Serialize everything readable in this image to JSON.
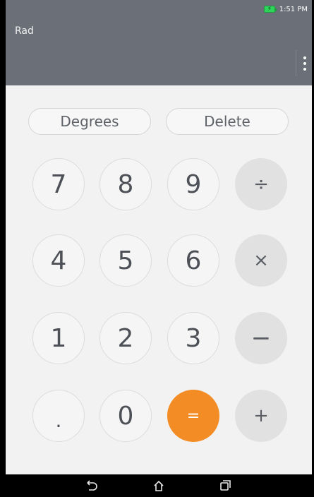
{
  "status_bar": {
    "time": "1:51 PM",
    "battery_icon": "battery-charging-icon"
  },
  "header": {
    "mode_label": "Rad",
    "display_value": "",
    "menu_icon": "overflow-menu-icon"
  },
  "actions": {
    "degrees_label": "Degrees",
    "delete_label": "Delete"
  },
  "keypad": {
    "seven": "7",
    "eight": "8",
    "nine": "9",
    "divide": "÷",
    "four": "4",
    "five": "5",
    "six": "6",
    "multiply": "×",
    "one": "1",
    "two": "2",
    "three": "3",
    "minus": "−",
    "dot": ".",
    "zero": "0",
    "equals": "=",
    "plus": "+"
  },
  "nav": {
    "back_icon": "back-arrow-icon",
    "home_icon": "home-icon",
    "recent_icon": "recent-apps-icon"
  },
  "colors": {
    "header_bg": "#6b6f77",
    "keypad_bg": "#f2f2f2",
    "equals_accent": "#f38c24",
    "battery": "#2fd45a"
  }
}
